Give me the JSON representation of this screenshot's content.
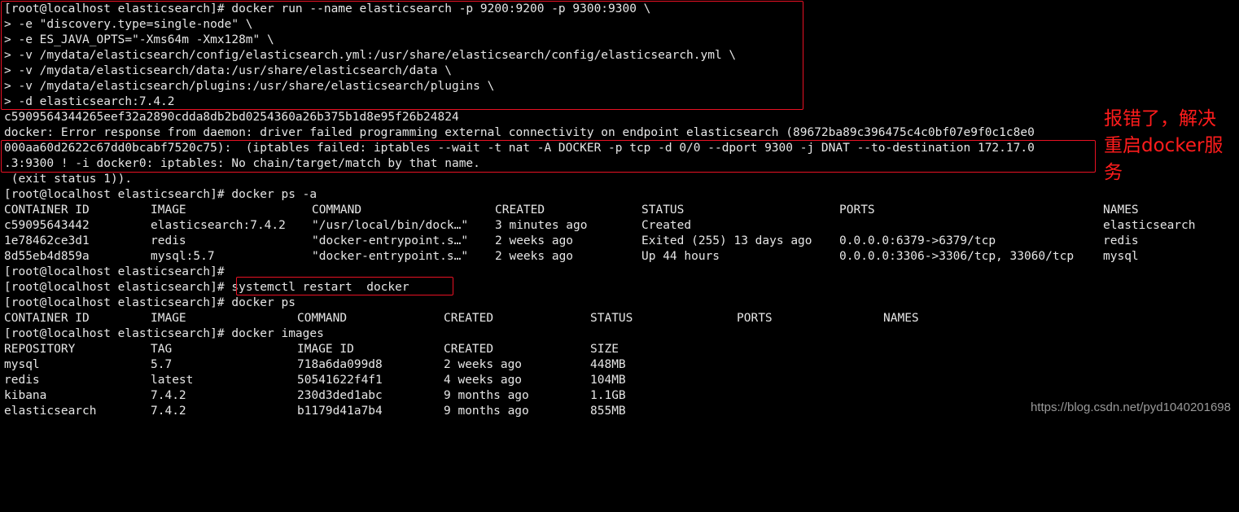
{
  "terminal": {
    "run_command": [
      "[root@localhost elasticsearch]# docker run --name elasticsearch -p 9200:9200 -p 9300:9300 \\",
      "> -e \"discovery.type=single-node\" \\",
      "> -e ES_JAVA_OPTS=\"-Xms64m -Xmx128m\" \\",
      "> -v /mydata/elasticsearch/config/elasticsearch.yml:/usr/share/elasticsearch/config/elasticsearch.yml \\",
      "> -v /mydata/elasticsearch/data:/usr/share/elasticsearch/data \\",
      "> -v /mydata/elasticsearch/plugins:/usr/share/elasticsearch/plugins \\",
      "> -d elasticsearch:7.4.2"
    ],
    "container_hash": "c5909564344265eef32a2890cdda8db2bd0254360a26b375b1d8e95f26b24824",
    "error_lines": [
      "docker: Error response from daemon: driver failed programming external connectivity on endpoint elasticsearch (89672ba89c396475c4c0bf07e9f0c1c8e0",
      "000aa60d2622c67dd0bcabf7520c75):  (iptables failed: iptables --wait -t nat -A DOCKER -p tcp -d 0/0 --dport 9300 -j DNAT --to-destination 172.17.0",
      ".3:9300 ! -i docker0: iptables: No chain/target/match by that name.",
      " (exit status 1))."
    ],
    "ps_a_prompt": "[root@localhost elasticsearch]# docker ps -a",
    "ps_a_headers": [
      "CONTAINER ID",
      "IMAGE",
      "COMMAND",
      "CREATED",
      "STATUS",
      "PORTS",
      "NAMES"
    ],
    "ps_a_rows": [
      [
        "c59095643442",
        "elasticsearch:7.4.2",
        "\"/usr/local/bin/dock…\"",
        "3 minutes ago",
        "Created",
        "",
        "elasticsearch"
      ],
      [
        "1e78462ce3d1",
        "redis",
        "\"docker-entrypoint.s…\"",
        "2 weeks ago",
        "Exited (255) 13 days ago",
        "0.0.0.0:6379->6379/tcp",
        "redis"
      ],
      [
        "8d55eb4d859a",
        "mysql:5.7",
        "\"docker-entrypoint.s…\"",
        "2 weeks ago",
        "Up 44 hours",
        "0.0.0.0:3306->3306/tcp, 33060/tcp",
        "mysql"
      ]
    ],
    "empty_prompt": "[root@localhost elasticsearch]#",
    "restart_prompt": "[root@localhost elasticsearch]# ",
    "restart_command": "systemctl restart  docker",
    "ps_prompt": "[root@localhost elasticsearch]# docker ps",
    "ps_headers": [
      "CONTAINER ID",
      "IMAGE",
      "COMMAND",
      "CREATED",
      "STATUS",
      "PORTS",
      "NAMES"
    ],
    "images_prompt": "[root@localhost elasticsearch]# docker images",
    "images_headers": [
      "REPOSITORY",
      "TAG",
      "IMAGE ID",
      "CREATED",
      "SIZE"
    ],
    "images_rows": [
      [
        "mysql",
        "5.7",
        "718a6da099d8",
        "2 weeks ago",
        "448MB"
      ],
      [
        "redis",
        "latest",
        "50541622f4f1",
        "4 weeks ago",
        "104MB"
      ],
      [
        "kibana",
        "7.4.2",
        "230d3ded1abc",
        "9 months ago",
        "1.1GB"
      ],
      [
        "elasticsearch",
        "7.4.2",
        "b1179d41a7b4",
        "9 months ago",
        "855MB"
      ]
    ]
  },
  "annotation": "报错了，解决重启docker服务",
  "watermark": "https://blog.csdn.net/pyd1040201698",
  "colors": {
    "background": "#000000",
    "text": "#e6e6e6",
    "highlight_box": "#e81123",
    "annotation": "#ff1c1c"
  }
}
